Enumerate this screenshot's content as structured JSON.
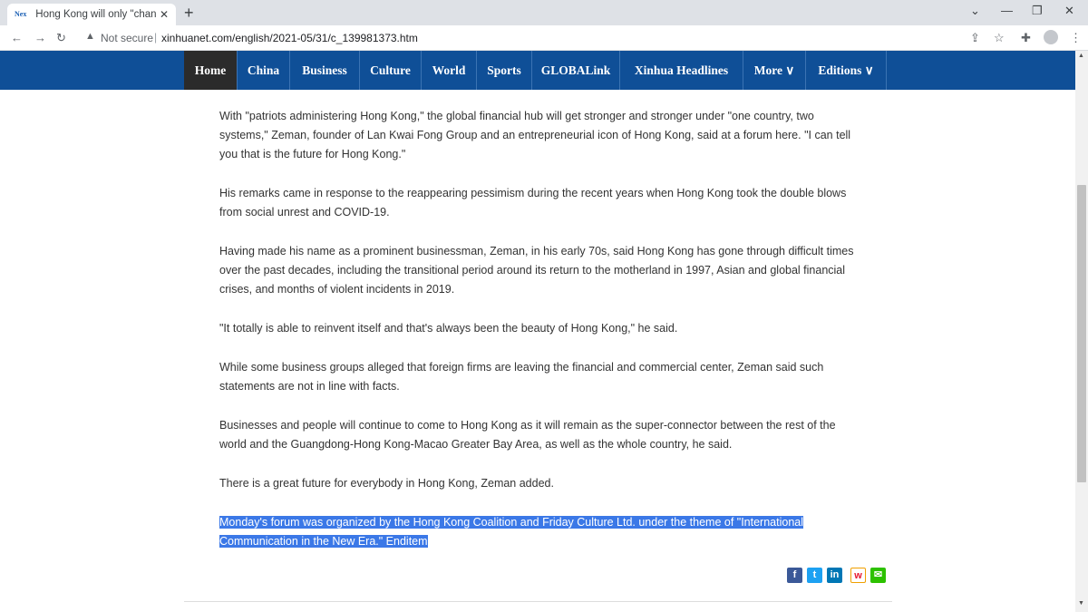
{
  "browser": {
    "tab_favicon": "Xinhua logo",
    "tab_favicon_text": "Nex",
    "tab_title": "Hong Kong will only \"change for",
    "tab_close": "✕",
    "new_tab": "+",
    "security_label": "Not secure",
    "url": "xinhuanet.com/english/2021-05/31/c_139981373.htm",
    "icons": [
      "back-icon",
      "forward-icon",
      "reload-icon",
      "warning-icon",
      "share-icon",
      "star-icon",
      "extensions-icon",
      "profile-icon",
      "menu-icon",
      "minimize-icon",
      "restore-icon",
      "close-icon",
      "tab-search-icon"
    ]
  },
  "nav": {
    "items": [
      {
        "label": "Home",
        "active": true
      },
      {
        "label": "China"
      },
      {
        "label": "Business"
      },
      {
        "label": "Culture"
      },
      {
        "label": "World"
      },
      {
        "label": "Sports"
      },
      {
        "label": "GLOBALink"
      },
      {
        "label": "Xinhua Headlines"
      },
      {
        "label": "More ∨"
      },
      {
        "label": "Editions ∨"
      }
    ],
    "bg_color": "#0f4f97",
    "active_color": "#2b2b2b"
  },
  "article": {
    "paragraphs": [
      "With \"patriots administering Hong Kong,\" the global financial hub will get stronger and stronger under \"one country, two systems,\" Zeman, founder of Lan Kwai Fong Group and an entrepreneurial icon of Hong Kong, said at a forum here. \"I can tell you that is the future for Hong Kong.\"",
      "His remarks came in response to the reappearing pessimism during the recent years when Hong Kong took the double blows from social unrest and COVID-19.",
      "Having made his name as a prominent businessman, Zeman, in his early 70s, said Hong Kong has gone through difficult times over the past decades, including the transitional period around its return to the motherland in 1997, Asian and global financial crises, and months of violent incidents in 2019.",
      "\"It totally is able to reinvent itself and that's always been the beauty of Hong Kong,\" he said.",
      "While some business groups alleged that foreign firms are leaving the financial and commercial center, Zeman said such statements are not in line with facts.",
      "Businesses and people will continue to come to Hong Kong as it will remain as the super-connector between the rest of the world and the Guangdong-Hong Kong-Macao Greater Bay Area, as well as the whole country, he said.",
      "There is a great future for everybody in Hong Kong, Zeman added."
    ],
    "selected_line1": "Monday's forum was organized by the Hong Kong Coalition and Friday Culture Ltd. under the theme of \"International",
    "selected_line2": "Communication in the New Era.\" Enditem",
    "selection_color": "#3b78e7"
  },
  "share": {
    "facebook": "f",
    "twitter": "t",
    "linkedin": "in",
    "weibo": "w",
    "wechat": "✉",
    "icons": [
      "facebook-icon",
      "twitter-icon",
      "linkedin-icon",
      "weibo-icon",
      "wechat-icon"
    ]
  }
}
